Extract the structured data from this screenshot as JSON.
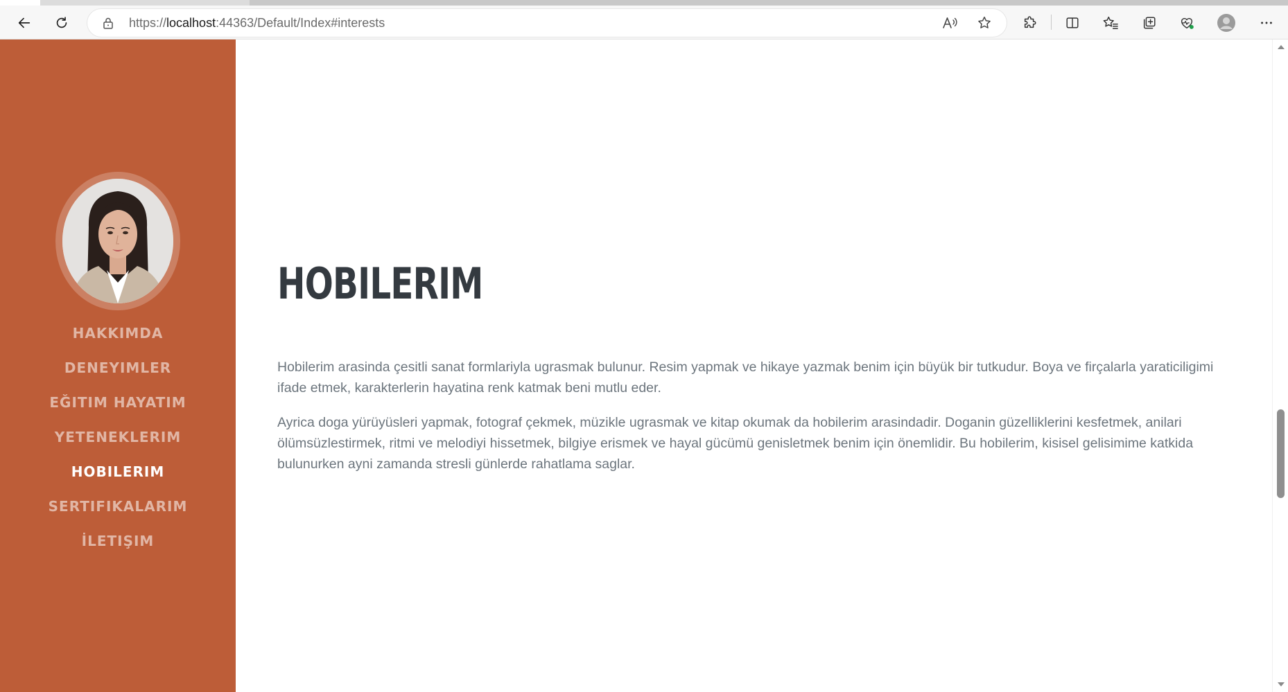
{
  "browser": {
    "url_scheme": "https://",
    "url_host": "localhost",
    "url_rest": ":44363/Default/Index#interests"
  },
  "nav": {
    "items": [
      {
        "label": "HAKKIMDA"
      },
      {
        "label": "DENEYIMLER"
      },
      {
        "label": "EĞITIM HAYATIM"
      },
      {
        "label": "YETENEKLERIM"
      },
      {
        "label": "HOBILERIM"
      },
      {
        "label": "SERTIFIKALARIM"
      },
      {
        "label": "İLETIŞIM"
      }
    ],
    "active_index": 4
  },
  "section": {
    "title": "HOBILERIM",
    "paragraph1": "Hobilerim arasinda çesitli sanat formlariyla ugrasmak bulunur. Resim yapmak ve hikaye yazmak benim için büyük bir tutkudur. Boya ve firçalarla yaraticiligimi ifade etmek, karakterlerin hayatina renk katmak beni mutlu eder.",
    "paragraph2": "Ayrica doga yürüyüsleri yapmak, fotograf çekmek, müzikle ugrasmak ve kitap okumak da hobilerim arasindadir. Doganin güzelliklerini kesfetmek, anilari ölümsüzlestirmek, ritmi ve melodiyi hissetmek, bilgiye erismek ve hayal gücümü genisletmek benim için önemlidir. Bu hobilerim, kisisel gelisimime katkida bulunurken ayni zamanda stresli günlerde rahatlama saglar."
  },
  "colors": {
    "sidebar_bg": "#bd5d38",
    "heading": "#343a40",
    "body_text": "#6c757d"
  },
  "icons": {
    "back": "arrow-left-icon",
    "refresh": "refresh-icon",
    "lock": "lock-icon",
    "read_aloud": "read-aloud-icon",
    "favorite": "star-icon",
    "extensions": "puzzle-icon",
    "split_screen": "split-screen-icon",
    "favorites_list": "favorites-icon",
    "collections": "collections-icon",
    "health": "browser-essentials-icon",
    "profile": "profile-icon",
    "menu": "more-icon"
  }
}
